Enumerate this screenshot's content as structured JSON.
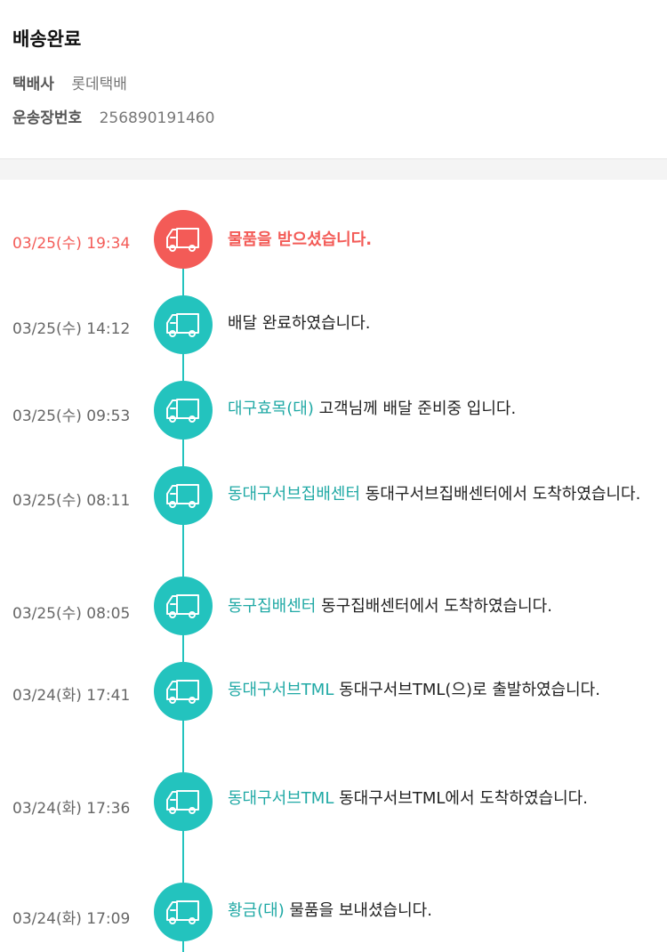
{
  "header": {
    "status": "배송완료",
    "courier_label": "택배사",
    "courier_value": "롯데택배",
    "tracking_label": "운송장번호",
    "tracking_value": "256890191460"
  },
  "colors": {
    "accent": "#23c3be",
    "active": "#f35b57",
    "place": "#20a9a5"
  },
  "timeline": [
    {
      "time": "03/25(수) 19:34",
      "place": "",
      "message": "물품을 받으셨습니다."
    },
    {
      "time": "03/25(수) 14:12",
      "place": "",
      "message": "배달 완료하였습니다."
    },
    {
      "time": "03/25(수) 09:53",
      "place": "대구효목(대)",
      "message": " 고객님께 배달 준비중 입니다."
    },
    {
      "time": "03/25(수) 08:11",
      "place": "동대구서브집배센터",
      "message": " 동대구서브집배센터에서 도착하였습니다."
    },
    {
      "time": "03/25(수) 08:05",
      "place": "동구집배센터",
      "message": " 동구집배센터에서 도착하였습니다."
    },
    {
      "time": "03/24(화) 17:41",
      "place": "동대구서브TML",
      "message": " 동대구서브TML(으)로 출발하였습니다."
    },
    {
      "time": "03/24(화) 17:36",
      "place": "동대구서브TML",
      "message": " 동대구서브TML에서 도착하였습니다."
    },
    {
      "time": "03/24(화) 17:09",
      "place": "황금(대)",
      "message": " 물품을 보내셨습니다."
    }
  ],
  "icons": {
    "step": "delivery-truck-icon"
  }
}
